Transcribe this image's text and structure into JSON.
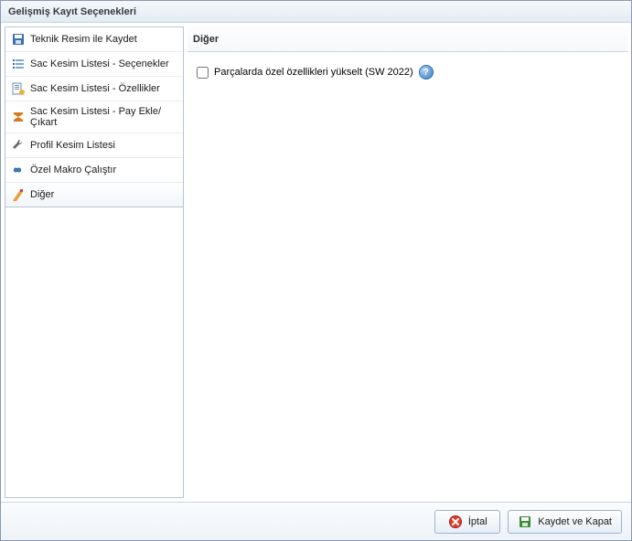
{
  "window": {
    "title": "Gelişmiş Kayıt Seçenekleri"
  },
  "sidebar": {
    "items": [
      {
        "label": "Teknik Resim ile Kaydet",
        "icon": "save-icon"
      },
      {
        "label": "Sac Kesim Listesi - Seçenekler",
        "icon": "list-options-icon"
      },
      {
        "label": "Sac Kesim Listesi - Özellikler",
        "icon": "list-properties-icon"
      },
      {
        "label": "Sac Kesim Listesi - Pay Ekle/Çıkart",
        "icon": "sigma-icon"
      },
      {
        "label": "Profil Kesim Listesi",
        "icon": "wrench-icon"
      },
      {
        "label": "Özel Makro Çalıştır",
        "icon": "infinity-icon"
      },
      {
        "label": "Diğer",
        "icon": "misc-icon",
        "active": true
      }
    ]
  },
  "content": {
    "title": "Diğer",
    "checkbox_label": "Parçalarda özel özellikleri yükselt (SW 2022)",
    "checkbox_checked": false,
    "help_glyph": "?"
  },
  "footer": {
    "cancel_label": "İptal",
    "save_label": "Kaydet ve Kapat"
  }
}
